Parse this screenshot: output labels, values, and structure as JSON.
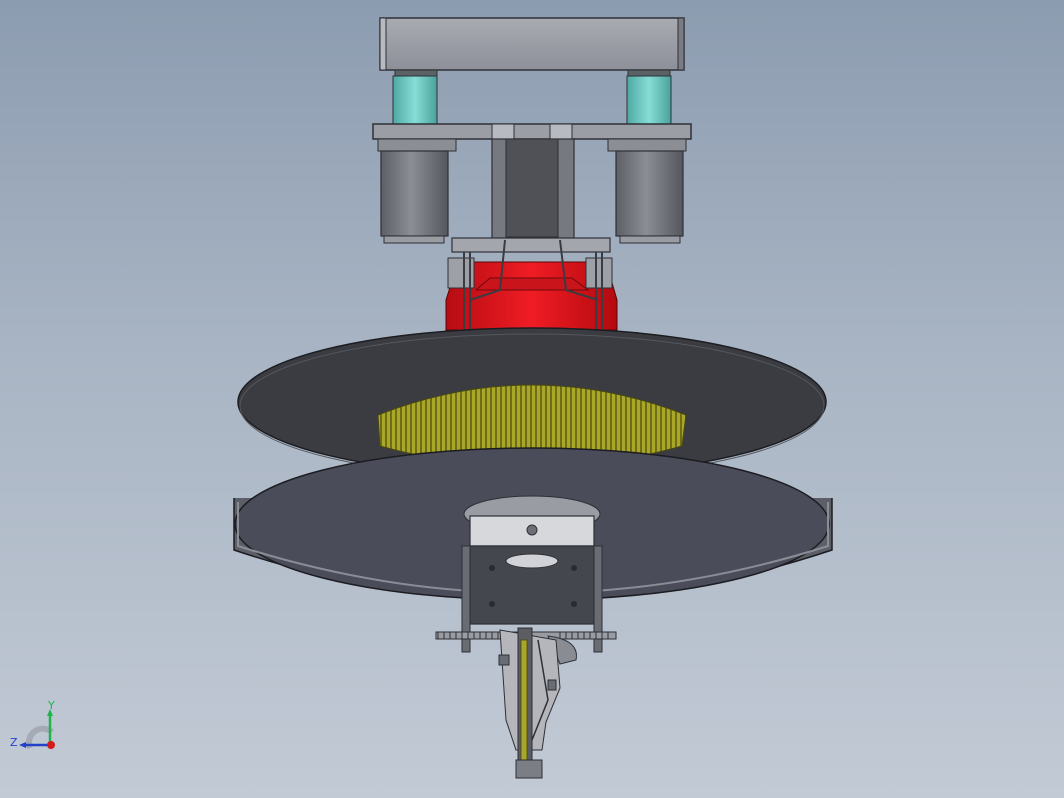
{
  "triad": {
    "x_label": "",
    "y_label": "Y",
    "z_label": "Z",
    "x_color": "#d41c1c",
    "y_color": "#22b24c",
    "z_color": "#2442c8"
  },
  "colors": {
    "background_top": "#8c9cb0",
    "background_bottom": "#c2cad5",
    "red_housing": "#e0141c",
    "teal_column": "#6ccdc5",
    "disc_dark": "#3c3e44",
    "disc_lower": "#4a4c5a",
    "gear_yellow": "#b6b42a",
    "motor_gray": "#6f7178"
  },
  "icons": [
    "view-orientation-triad-icon"
  ]
}
